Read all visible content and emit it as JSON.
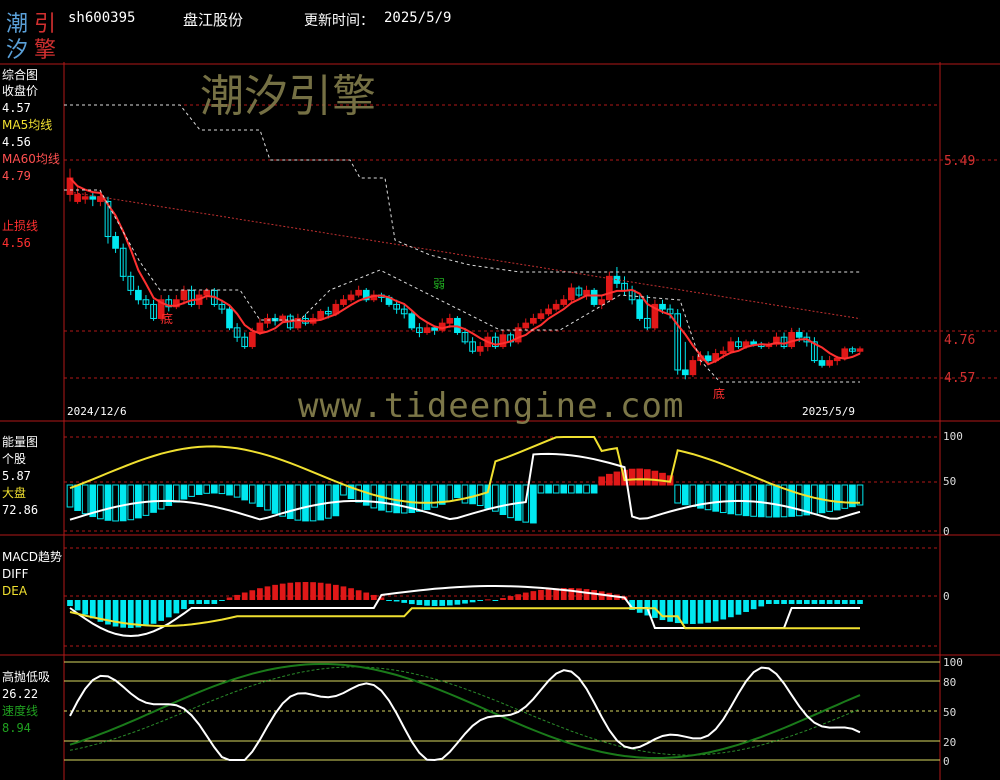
{
  "logo": {
    "chars": [
      "潮",
      "引",
      "汐",
      "擎"
    ],
    "colors": [
      "#5aa0d8",
      "#d23030",
      "#5aa0d8",
      "#d23030"
    ]
  },
  "header": {
    "code": "sh600395",
    "name": "盘江股份",
    "update_label": "更新时间：",
    "update_date": "2025/5/9"
  },
  "watermarks": {
    "brand": "潮汐引擎",
    "url": "www.tideengine.com"
  },
  "colors": {
    "up": "#e01818",
    "down": "#00e8f0",
    "grid": "#b01818",
    "ma5": "#ffffff",
    "ma60": "#ff3030",
    "stop": "#ff3030",
    "yellow": "#f0e030",
    "green": "#1a7a1a",
    "white": "#ffffff"
  },
  "main_panel": {
    "title": "综合图",
    "close_label": "收盘价",
    "close_value": "4.57",
    "ma5_label": "MA5均线",
    "ma5_value": "4.56",
    "ma60_label": "MA60均线",
    "ma60_value": "4.79",
    "stop_label": "止损线",
    "stop_value": "4.56",
    "price_levels": [
      "5.49",
      "4.76",
      "4.57"
    ],
    "date_start": "2024/12/6",
    "date_end": "2025/5/9",
    "marks": [
      "底",
      "弱",
      "底"
    ]
  },
  "energy_panel": {
    "title": "能量图",
    "stock_label": "个股",
    "stock_value": "5.87",
    "market_label": "大盘",
    "market_value": "72.86",
    "ticks": [
      "100",
      "50",
      "0"
    ]
  },
  "macd_panel": {
    "title": "MACD趋势",
    "diff_label": "DIFF",
    "dea_label": "DEA",
    "ticks": [
      "0"
    ]
  },
  "osc_panel": {
    "title": "高抛低吸",
    "value": "26.22",
    "speed_label": "速度线",
    "speed_value": "8.94",
    "ticks": [
      "100",
      "80",
      "50",
      "20",
      "0"
    ]
  },
  "series": {
    "candles": [
      [
        5.23,
        5.3,
        5.2,
        5.34,
        5.18
      ],
      [
        5.2,
        5.23,
        5.19,
        5.26,
        5.17
      ],
      [
        5.21,
        5.22,
        5.19,
        5.24,
        5.18
      ],
      [
        5.22,
        5.21,
        5.18,
        5.24,
        5.16
      ],
      [
        5.2,
        5.22,
        5.18,
        5.25,
        5.17
      ],
      [
        5.2,
        5.05,
        5.02,
        5.22,
        5.0
      ],
      [
        5.05,
        5.0,
        4.98,
        5.07,
        4.96
      ],
      [
        5.0,
        4.88,
        4.86,
        5.02,
        4.84
      ],
      [
        4.88,
        4.82,
        4.8,
        4.9,
        4.78
      ],
      [
        4.82,
        4.78,
        4.76,
        4.84,
        4.74
      ],
      [
        4.78,
        4.76,
        4.74,
        4.8,
        4.72
      ],
      [
        4.76,
        4.7,
        4.69,
        4.78,
        4.67
      ],
      [
        4.7,
        4.78,
        4.69,
        4.8,
        4.68
      ],
      [
        4.78,
        4.75,
        4.73,
        4.8,
        4.72
      ],
      [
        4.75,
        4.78,
        4.74,
        4.8,
        4.73
      ],
      [
        4.78,
        4.82,
        4.76,
        4.84,
        4.75
      ],
      [
        4.82,
        4.76,
        4.75,
        4.84,
        4.74
      ],
      [
        4.76,
        4.8,
        4.74,
        4.82,
        4.73
      ],
      [
        4.8,
        4.82,
        4.78,
        4.83,
        4.77
      ],
      [
        4.82,
        4.76,
        4.75,
        4.83,
        4.74
      ],
      [
        4.76,
        4.74,
        4.72,
        4.78,
        4.71
      ],
      [
        4.74,
        4.66,
        4.65,
        4.76,
        4.64
      ],
      [
        4.66,
        4.62,
        4.6,
        4.68,
        4.59
      ],
      [
        4.62,
        4.58,
        4.57,
        4.64,
        4.56
      ],
      [
        4.58,
        4.64,
        4.57,
        4.66,
        4.56
      ],
      [
        4.64,
        4.68,
        4.63,
        4.7,
        4.62
      ],
      [
        4.68,
        4.7,
        4.66,
        4.72,
        4.65
      ],
      [
        4.7,
        4.69,
        4.67,
        4.72,
        4.66
      ],
      [
        4.69,
        4.71,
        4.68,
        4.72,
        4.67
      ],
      [
        4.71,
        4.66,
        4.65,
        4.72,
        4.64
      ],
      [
        4.66,
        4.7,
        4.65,
        4.72,
        4.64
      ],
      [
        4.7,
        4.68,
        4.67,
        4.72,
        4.66
      ],
      [
        4.68,
        4.7,
        4.67,
        4.72,
        4.66
      ],
      [
        4.7,
        4.73,
        4.69,
        4.74,
        4.68
      ],
      [
        4.73,
        4.72,
        4.7,
        4.75,
        4.69
      ],
      [
        4.72,
        4.76,
        4.71,
        4.78,
        4.7
      ],
      [
        4.76,
        4.78,
        4.75,
        4.8,
        4.74
      ],
      [
        4.78,
        4.8,
        4.77,
        4.82,
        4.76
      ],
      [
        4.8,
        4.82,
        4.79,
        4.84,
        4.78
      ],
      [
        4.82,
        4.78,
        4.77,
        4.83,
        4.76
      ],
      [
        4.78,
        4.8,
        4.77,
        4.82,
        4.76
      ],
      [
        4.8,
        4.79,
        4.77,
        4.81,
        4.76
      ],
      [
        4.79,
        4.76,
        4.75,
        4.8,
        4.74
      ],
      [
        4.76,
        4.74,
        4.72,
        4.78,
        4.71
      ],
      [
        4.74,
        4.72,
        4.7,
        4.76,
        4.69
      ],
      [
        4.72,
        4.66,
        4.65,
        4.73,
        4.64
      ],
      [
        4.66,
        4.64,
        4.62,
        4.68,
        4.61
      ],
      [
        4.64,
        4.66,
        4.63,
        4.68,
        4.62
      ],
      [
        4.66,
        4.65,
        4.63,
        4.67,
        4.62
      ],
      [
        4.65,
        4.68,
        4.64,
        4.7,
        4.63
      ],
      [
        4.68,
        4.7,
        4.66,
        4.72,
        4.65
      ],
      [
        4.7,
        4.64,
        4.63,
        4.71,
        4.62
      ],
      [
        4.64,
        4.6,
        4.59,
        4.66,
        4.58
      ],
      [
        4.6,
        4.56,
        4.55,
        4.62,
        4.54
      ],
      [
        4.56,
        4.58,
        4.54,
        4.6,
        4.53
      ],
      [
        4.58,
        4.62,
        4.56,
        4.64,
        4.55
      ],
      [
        4.62,
        4.58,
        4.57,
        4.64,
        4.56
      ],
      [
        4.58,
        4.63,
        4.57,
        4.65,
        4.56
      ],
      [
        4.63,
        4.6,
        4.58,
        4.64,
        4.57
      ],
      [
        4.6,
        4.66,
        4.59,
        4.68,
        4.58
      ],
      [
        4.66,
        4.68,
        4.65,
        4.7,
        4.64
      ],
      [
        4.68,
        4.7,
        4.67,
        4.72,
        4.66
      ],
      [
        4.7,
        4.72,
        4.69,
        4.74,
        4.68
      ],
      [
        4.72,
        4.74,
        4.71,
        4.76,
        4.7
      ],
      [
        4.74,
        4.76,
        4.73,
        4.78,
        4.72
      ],
      [
        4.76,
        4.78,
        4.75,
        4.8,
        4.74
      ],
      [
        4.78,
        4.83,
        4.77,
        4.85,
        4.76
      ],
      [
        4.83,
        4.8,
        4.79,
        4.84,
        4.78
      ],
      [
        4.8,
        4.82,
        4.78,
        4.84,
        4.77
      ],
      [
        4.82,
        4.76,
        4.75,
        4.83,
        4.74
      ],
      [
        4.76,
        4.78,
        4.74,
        4.8,
        4.73
      ],
      [
        4.78,
        4.88,
        4.77,
        4.9,
        4.76
      ],
      [
        4.88,
        4.85,
        4.83,
        4.92,
        4.82
      ],
      [
        4.85,
        4.82,
        4.8,
        4.88,
        4.79
      ],
      [
        4.82,
        4.78,
        4.76,
        4.84,
        4.75
      ],
      [
        4.78,
        4.7,
        4.69,
        4.8,
        4.68
      ],
      [
        4.7,
        4.66,
        4.65,
        4.8,
        4.64
      ],
      [
        4.66,
        4.76,
        4.65,
        4.78,
        4.64
      ],
      [
        4.76,
        4.74,
        4.72,
        4.78,
        4.71
      ],
      [
        4.74,
        4.72,
        4.7,
        4.76,
        4.69
      ],
      [
        4.72,
        4.48,
        4.46,
        4.74,
        4.45
      ],
      [
        4.48,
        4.46,
        4.44,
        4.6,
        4.43
      ],
      [
        4.46,
        4.52,
        4.45,
        4.54,
        4.44
      ],
      [
        4.52,
        4.54,
        4.5,
        4.56,
        4.49
      ],
      [
        4.54,
        4.52,
        4.51,
        4.56,
        4.5
      ],
      [
        4.52,
        4.55,
        4.51,
        4.57,
        4.5
      ],
      [
        4.55,
        4.56,
        4.53,
        4.58,
        4.52
      ],
      [
        4.56,
        4.6,
        4.55,
        4.62,
        4.54
      ],
      [
        4.6,
        4.58,
        4.57,
        4.62,
        4.56
      ],
      [
        4.58,
        4.6,
        4.57,
        4.61,
        4.56
      ],
      [
        4.6,
        4.59,
        4.58,
        4.61,
        4.57
      ],
      [
        4.59,
        4.58,
        4.57,
        4.6,
        4.56
      ],
      [
        4.58,
        4.59,
        4.57,
        4.6,
        4.56
      ],
      [
        4.59,
        4.62,
        4.58,
        4.64,
        4.57
      ],
      [
        4.62,
        4.58,
        4.57,
        4.64,
        4.56
      ],
      [
        4.58,
        4.64,
        4.57,
        4.66,
        4.56
      ],
      [
        4.64,
        4.62,
        4.6,
        4.66,
        4.59
      ],
      [
        4.62,
        4.6,
        4.58,
        4.64,
        4.57
      ],
      [
        4.6,
        4.52,
        4.51,
        4.62,
        4.5
      ],
      [
        4.52,
        4.5,
        4.49,
        4.54,
        4.48
      ],
      [
        4.5,
        4.52,
        4.49,
        4.54,
        4.48
      ],
      [
        4.52,
        4.53,
        4.5,
        4.54,
        4.49
      ],
      [
        4.53,
        4.57,
        4.52,
        4.58,
        4.51
      ],
      [
        4.57,
        4.56,
        4.55,
        4.58,
        4.54
      ],
      [
        4.56,
        4.57,
        4.55,
        4.58,
        4.54
      ]
    ]
  }
}
